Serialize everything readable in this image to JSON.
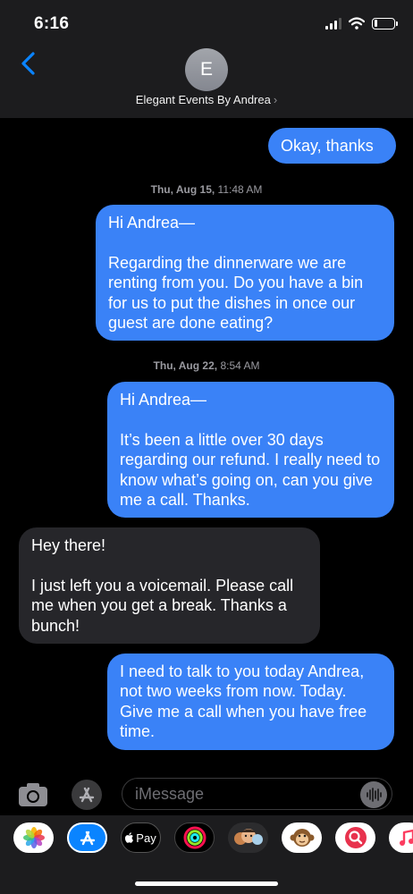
{
  "status_bar": {
    "time": "6:16",
    "battery_percent": 15
  },
  "header": {
    "avatar_initial": "E",
    "contact_name": "Elegant Events By Andrea",
    "chevron": "›"
  },
  "thread": {
    "messages": [
      {
        "type": "sent",
        "text": "Okay, thanks"
      },
      {
        "type": "timestamp",
        "day": "Thu, Aug 15,",
        "time": "11:48 AM"
      },
      {
        "type": "sent",
        "text": "Hi Andrea—\n\nRegarding the dinnerware we are renting from you. Do you have a bin for us to put the dishes in once our guest are done eating?"
      },
      {
        "type": "timestamp",
        "day": "Thu, Aug 22,",
        "time": "8:54 AM"
      },
      {
        "type": "sent",
        "text": "Hi Andrea—\n\nIt’s been a little over 30 days regarding our refund. I really need to know what’s going on, can you give me a call. Thanks."
      },
      {
        "type": "received",
        "text": "Hey there!\n\nI just left you a voicemail. Please call me when you get a break. Thanks a bunch!"
      },
      {
        "type": "sent",
        "text": "I need to talk to you today Andrea, not two weeks from now. Today. Give me a call when you have free time."
      }
    ]
  },
  "input": {
    "placeholder": "iMessage"
  },
  "app_drawer": {
    "apps": [
      "photos-app",
      "app-store-app",
      "apple-pay-app",
      "activity-app",
      "memoji-app",
      "animoji-app",
      "web-search-app",
      "music-app"
    ],
    "apple_pay_label": "Pay"
  },
  "colors": {
    "sent_bubble": "#3a82f7",
    "received_bubble": "#26262a",
    "accent": "#0a84ff",
    "header_bg": "#1c1c1e"
  }
}
